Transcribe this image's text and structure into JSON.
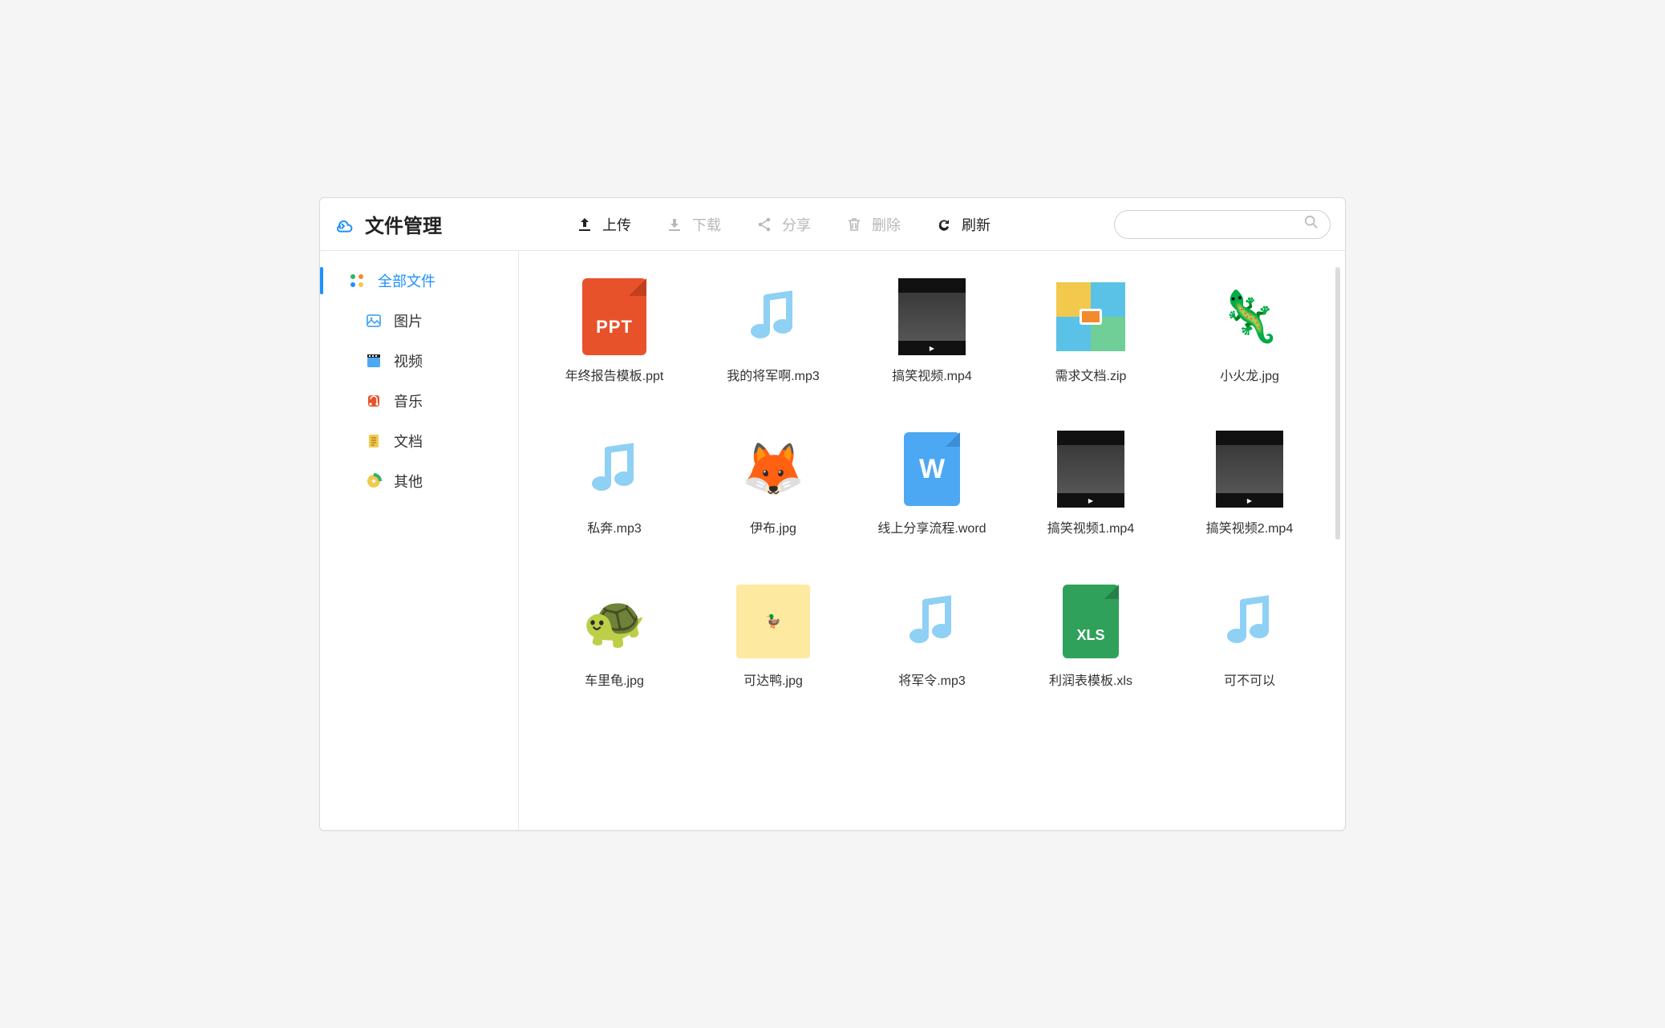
{
  "header": {
    "title": "文件管理",
    "toolbar": {
      "upload": "上传",
      "download": "下载",
      "share": "分享",
      "delete": "删除",
      "refresh": "刷新"
    },
    "search_placeholder": ""
  },
  "sidebar": {
    "items": [
      {
        "label": "全部文件",
        "icon": "grid-icon",
        "active": true
      },
      {
        "label": "图片",
        "icon": "image-icon"
      },
      {
        "label": "视频",
        "icon": "video-icon"
      },
      {
        "label": "音乐",
        "icon": "music-icon"
      },
      {
        "label": "文档",
        "icon": "document-icon"
      },
      {
        "label": "其他",
        "icon": "disc-icon"
      }
    ]
  },
  "files": [
    {
      "name": "年终报告模板.ppt",
      "type": "ppt"
    },
    {
      "name": "我的将军啊.mp3",
      "type": "audio"
    },
    {
      "name": "搞笑视频.mp4",
      "type": "video"
    },
    {
      "name": "需求文档.zip",
      "type": "zip"
    },
    {
      "name": "小火龙.jpg",
      "type": "image-charmander"
    },
    {
      "name": "私奔.mp3",
      "type": "audio"
    },
    {
      "name": "伊布.jpg",
      "type": "image-eevee"
    },
    {
      "name": "线上分享流程.word",
      "type": "word"
    },
    {
      "name": "搞笑视频1.mp4",
      "type": "video"
    },
    {
      "name": "搞笑视频2.mp4",
      "type": "video"
    },
    {
      "name": "车里龟.jpg",
      "type": "image-squirtle"
    },
    {
      "name": "可达鸭.jpg",
      "type": "image-psyduck"
    },
    {
      "name": "将军令.mp3",
      "type": "audio"
    },
    {
      "name": "利润表模板.xls",
      "type": "xls"
    },
    {
      "name": "可不可以",
      "type": "audio"
    }
  ],
  "doc_labels": {
    "ppt": "PPT",
    "word": "W",
    "xls": "XLS"
  }
}
